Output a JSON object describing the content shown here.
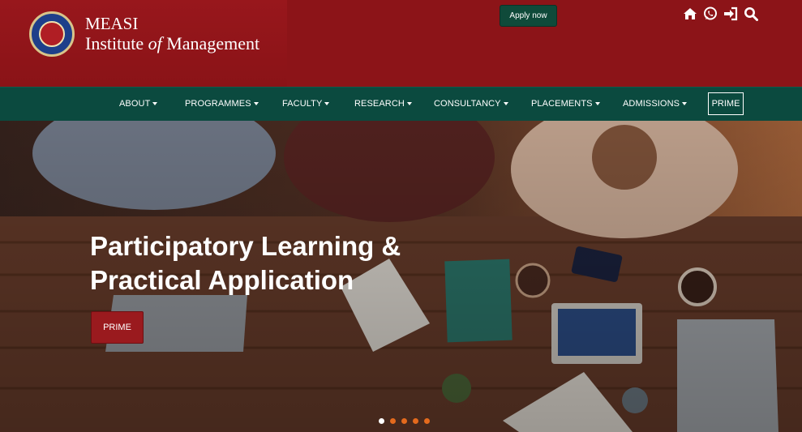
{
  "header": {
    "brand_name": "MEASI",
    "brand_sub_pre": "Institute ",
    "brand_sub_italic": "of",
    "brand_sub_post": " Management",
    "apply_label": "Apply now",
    "icons": [
      "home-icon",
      "whatsapp-icon",
      "sign-in-icon",
      "search-icon"
    ]
  },
  "nav": {
    "items": [
      {
        "label": "ABOUT"
      },
      {
        "label": "PROGRAMMES"
      },
      {
        "label": "FACULTY"
      },
      {
        "label": "RESEARCH"
      },
      {
        "label": "CONSULTANCY"
      },
      {
        "label": "PLACEMENTS"
      },
      {
        "label": "ADMISSIONS"
      }
    ],
    "prime_label": "PRIME"
  },
  "hero": {
    "title_line1": "Participatory Learning &",
    "title_line2": "Practical Application",
    "button_label": "PRIME",
    "slides": 5,
    "active_slide": 1
  },
  "colors": {
    "header_bg": "#8c1418",
    "nav_bg": "#0b4a3f",
    "apply_bg": "#0f4a3a",
    "accent_dot": "#e46a1d"
  }
}
